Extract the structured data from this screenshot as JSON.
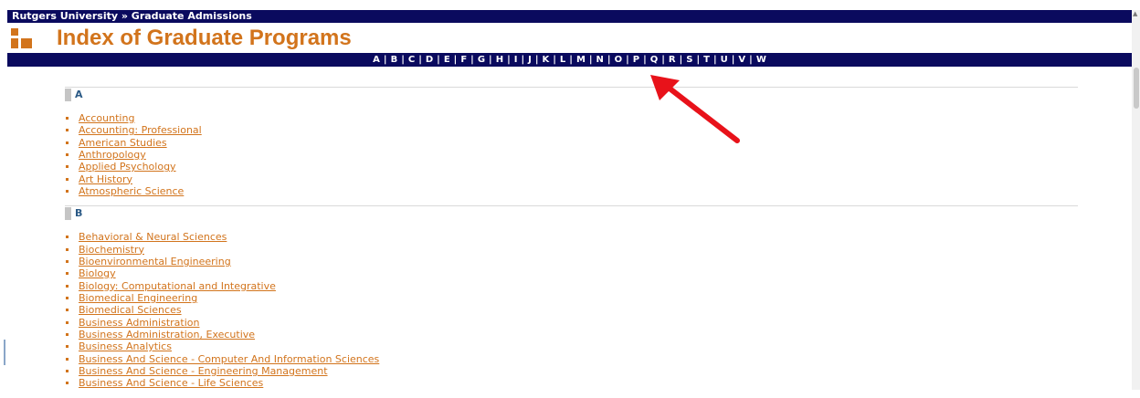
{
  "header": {
    "breadcrumb": "Rutgers University » Graduate Admissions",
    "title": "Index of Graduate Programs"
  },
  "alphabet": [
    "A",
    "B",
    "C",
    "D",
    "E",
    "F",
    "G",
    "H",
    "I",
    "J",
    "K",
    "L",
    "M",
    "N",
    "O",
    "P",
    "Q",
    "R",
    "S",
    "T",
    "U",
    "V",
    "W"
  ],
  "sections": [
    {
      "letter": "A",
      "programs": [
        "Accounting",
        "Accounting: Professional",
        "American Studies",
        "Anthropology",
        "Applied Psychology",
        "Art History",
        "Atmospheric Science"
      ]
    },
    {
      "letter": "B",
      "programs": [
        "Behavioral & Neural Sciences",
        "Biochemistry",
        "Bioenvironmental Engineering",
        "Biology",
        "Biology: Computational and Integrative",
        "Biomedical Engineering",
        "Biomedical Sciences",
        "Business Administration",
        "Business Administration, Executive",
        "Business Analytics",
        "Business And Science - Computer And Information Sciences",
        "Business And Science - Engineering Management",
        "Business And Science - Life Sciences"
      ]
    }
  ],
  "colors": {
    "navy": "#0a0a5e",
    "orange": "#d2741c",
    "section_letter": "#2b5a86",
    "annotation_arrow": "#e8121a"
  },
  "icons": {
    "logo": "rutgers-squares-logo",
    "arrow": "red-annotation-arrow"
  }
}
